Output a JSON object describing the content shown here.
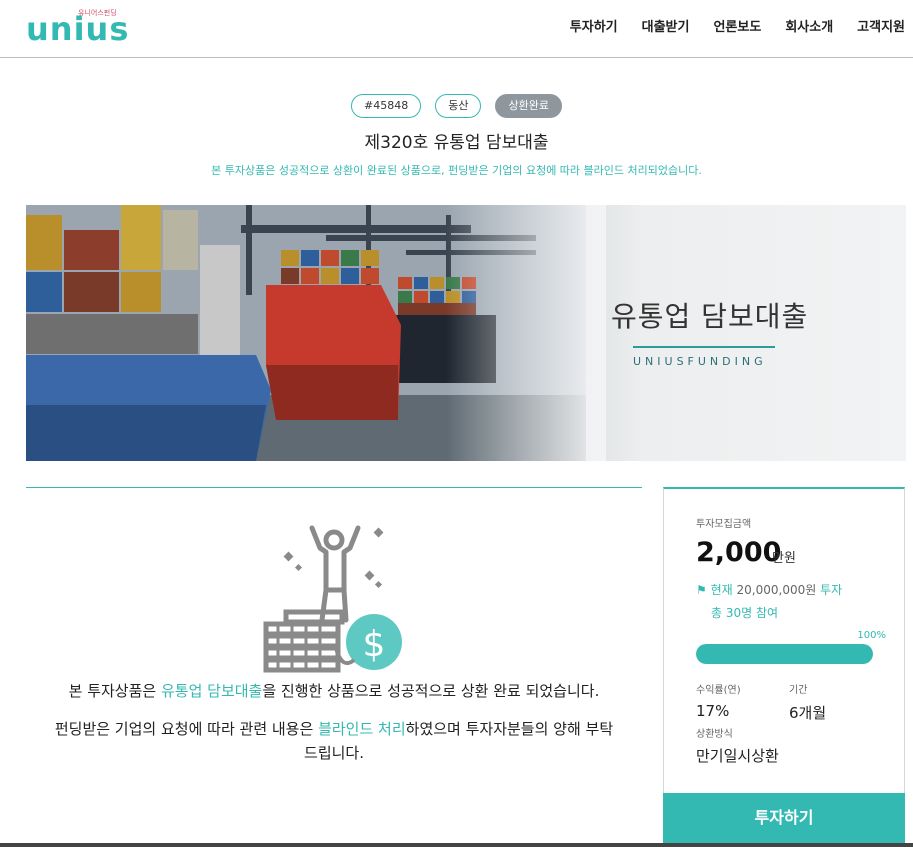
{
  "header": {
    "logo_text": "unius",
    "logo_sub": "유니어스펀딩",
    "nav": [
      "투자하기",
      "대출받기",
      "언론보도",
      "회사소개",
      "고객지원"
    ]
  },
  "product": {
    "tags": [
      "#45848",
      "동산",
      "상환완료"
    ],
    "title": "제320호 유통업 담보대출",
    "notice": "본 투자상품은 성공적으로 상환이 완료된 상품으로, 펀딩받은 기업의 요청에 따라 블라인드 처리되었습니다."
  },
  "banner": {
    "title": "유통업 담보대출",
    "subtitle": "UNIUSFUNDING"
  },
  "content": {
    "msg1_a": "본 투자상품은 ",
    "msg1_hl": "유통업 담보대출",
    "msg1_b": "을 진행한 상품으로 성공적으로 상환 완료 되었습니다.",
    "msg2_a": "펀딩받은 기업의 요청에 따라 관련 내용은 ",
    "msg2_hl": "블라인드 처리",
    "msg2_b": "하였으며 투자자분들의 양해 부탁",
    "msg2_c": "드립니다."
  },
  "card": {
    "amount_label": "투자모집금액",
    "amount": "2,000",
    "amount_unit": "만원",
    "status_prefix": "현재",
    "status_amount": "20,000,000원",
    "status_suffix": "투자",
    "participants": "총 30명 참여",
    "progress_label": "100%",
    "progress": 1.0,
    "rate_label": "수익률(연)",
    "rate": "17%",
    "period_label": "기간",
    "period": "6개월",
    "method_label": "상환방식",
    "method": "만기일시상환",
    "invest_button": "투자하기"
  },
  "colors": {
    "accent": "#34b9b2",
    "tag_done": "#8e979e"
  }
}
